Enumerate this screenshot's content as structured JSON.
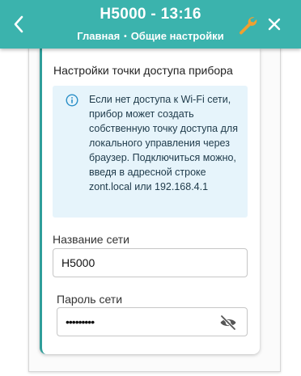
{
  "header": {
    "title": "H5000 - 13:16",
    "breadcrumb": [
      "Главная",
      "Общие настройки"
    ],
    "breadcrumb_separator": "•",
    "background_color": "#3bb3ad",
    "icons": [
      "chevron-left-icon",
      "wrench-icon",
      "close-icon"
    ],
    "wrench_color": "#f0a030"
  },
  "card": {
    "title": "Настройки точки доступа прибора",
    "accent_color": "#2f9e9a",
    "info": {
      "icon": "info-icon",
      "text": "Если нет доступа к Wi-Fi сети, прибор может создать собственную точку доступа для локального управления через браузер. Подключиться можно, введя в адресной строке zont.local или 192.168.4.1"
    },
    "network_name": {
      "label": "Название сети",
      "value": "H5000"
    },
    "network_password": {
      "label": "Пароль сети",
      "value": "•••••••••",
      "toggle_icon": "eye-off-icon"
    }
  }
}
